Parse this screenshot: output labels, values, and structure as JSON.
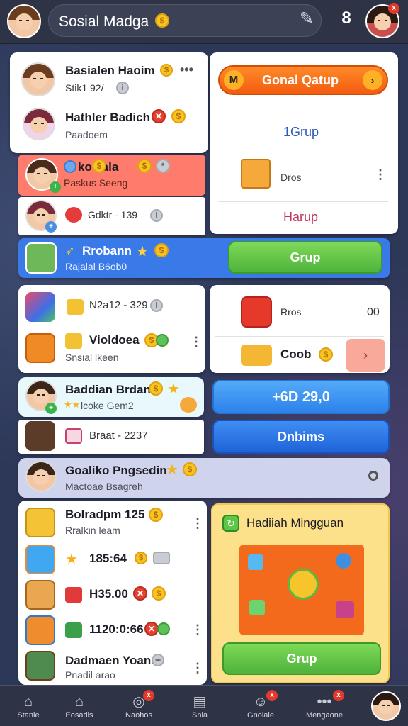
{
  "header": {
    "title": "Sosial Madga",
    "icons": [
      "avatar",
      "coin-icon",
      "pencil-icon",
      "notification-icon",
      "profile-avatar"
    ]
  },
  "left_list": [
    {
      "name": "Basialen Haoim",
      "sub": "Stik1 92/",
      "icons": [
        "coin",
        "dots"
      ]
    },
    {
      "name": "Hathler Badich",
      "sub": "Paadoem",
      "icons": [
        "red-coin",
        "coin"
      ]
    },
    {
      "name": "ko Tala",
      "sub": "Paskus Seeng",
      "icons": [
        "coin",
        "coin",
        "coin"
      ],
      "highlight": "#ff7b6b"
    },
    {
      "name": "",
      "sub": "Gdktr - 139",
      "icons": [
        "red-gem",
        "grey-coin"
      ]
    }
  ],
  "right_top": {
    "header_label": "Gonal Qatup",
    "group_link": "1Grup",
    "item_label": "Dros",
    "footer_link": "Harup"
  },
  "blue_banner": {
    "name": "Rrobann",
    "sub": "Rajalal B6ob0",
    "button": "Grup"
  },
  "mid_left": [
    {
      "name": "",
      "sub": "N2a12 - 329"
    },
    {
      "name": "Violdoea",
      "sub": "Snsial lkeen"
    }
  ],
  "mid_right": [
    {
      "label": "Rros",
      "value": "00"
    },
    {
      "label": "Coob"
    }
  ],
  "cyan_row": {
    "name": "Baddian Brdan",
    "sub": "lcoke Gem2"
  },
  "plain_row": {
    "sub": "Braat - 2237"
  },
  "amount_button": "+6D 29,0",
  "dnbms_button": "Dnbims",
  "lavender_row": {
    "name": "Goaliko Pngsedin",
    "sub": "Mactoae Bsagreh"
  },
  "bottom_left": [
    {
      "name": "Bolradpm 125",
      "sub": "Rralkin leam"
    },
    {
      "name": "",
      "sub": "185:64"
    },
    {
      "name": "",
      "sub": "H35.00"
    },
    {
      "name": "",
      "sub": "1120:0:66"
    },
    {
      "name": "Dadmaen Yoann",
      "sub": "Pnadil arao"
    }
  ],
  "reward_card": {
    "title": "Hadiiah Mingguan",
    "button": "Grup"
  },
  "tabs": [
    {
      "label": "Stanle",
      "icon": "home-icon"
    },
    {
      "label": "Eosadis",
      "icon": "home-icon"
    },
    {
      "label": "Naohos",
      "icon": "compass-icon"
    },
    {
      "label": "Snia",
      "icon": "chat-icon"
    },
    {
      "label": "Gnolaie",
      "icon": "game-icon"
    },
    {
      "label": "Mengaone",
      "icon": "dots-icon"
    }
  ],
  "colors": {
    "topbar": "#2e3446",
    "accent_orange": "#ff6a1a",
    "banner_blue": "#3a7ae8",
    "green_button": "#5cc745",
    "highlight_red": "#ff7b6b",
    "lavender": "#cfd3ec",
    "reward_yellow": "#fce08a"
  }
}
